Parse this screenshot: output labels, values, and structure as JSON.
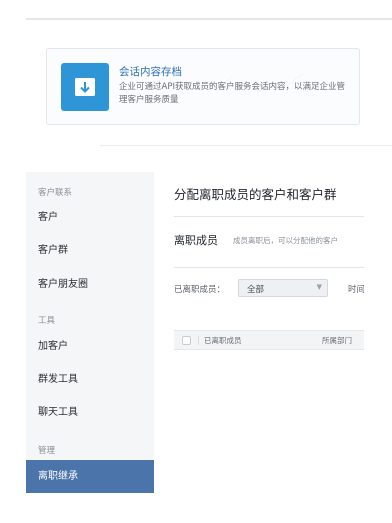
{
  "promo": {
    "title": "会话内容存档",
    "description": "企业可通过API获取成员的客户服务会话内容，以满足企业管理客户服务质量",
    "icon": "download-icon",
    "accent_color": "#2e96d6"
  },
  "sidebar": {
    "groups": {
      "customer_contact": "客户联系",
      "tools": "工具",
      "management": "管理"
    },
    "items": [
      {
        "label": "客户"
      },
      {
        "label": "客户群"
      },
      {
        "label": "客户朋友圈"
      },
      {
        "label": "加客户"
      },
      {
        "label": "群发工具"
      },
      {
        "label": "聊天工具"
      },
      {
        "label": "离职继承"
      }
    ],
    "active_color": "#4a74aa"
  },
  "main": {
    "title": "分配离职成员的客户和客户群",
    "section": {
      "title": "离职成员",
      "hint": "成员离职后，可以分配他的客户"
    },
    "filter": {
      "label": "已离职成员：",
      "select_value": "全部",
      "second_label": "时间"
    },
    "table": {
      "columns": [
        "已离职成员",
        "所属部门"
      ]
    }
  }
}
